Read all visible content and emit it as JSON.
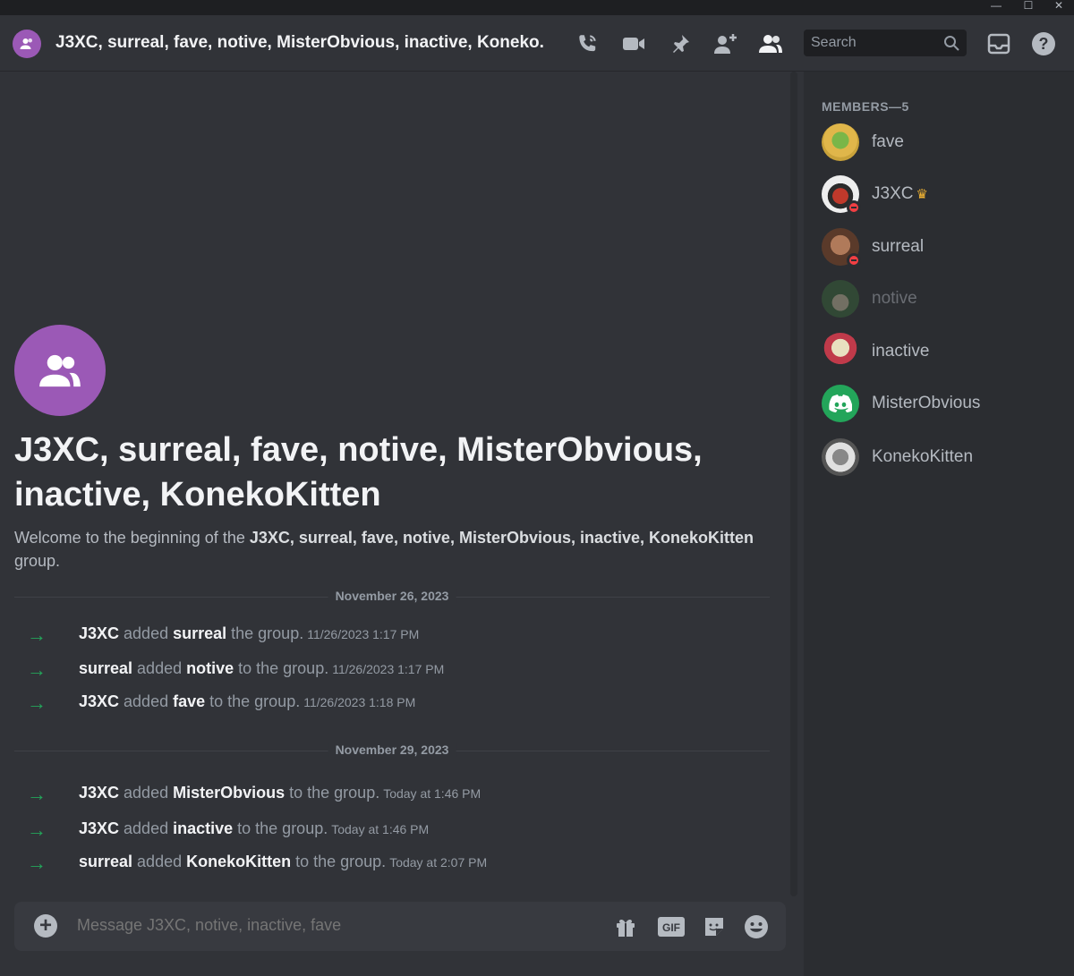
{
  "window": {
    "minimize": "—",
    "maximize": "☐",
    "close": "✕"
  },
  "header": {
    "title": "J3XC, surreal, fave, notive, MisterObvious, inactive, Koneko...",
    "search_placeholder": "Search",
    "icons": [
      "call-icon",
      "video-icon",
      "pin-icon",
      "add-friend-icon",
      "members-icon",
      "inbox-icon",
      "help-icon"
    ]
  },
  "intro": {
    "group_name": "J3XC, surreal, fave, notive, MisterObvious, inactive, KonekoKitten",
    "welcome_prefix": "Welcome to the beginning of the ",
    "welcome_names": "J3XC, surreal, fave, notive, MisterObvious, inactive, KonekoKitten",
    "welcome_suffix": " group."
  },
  "dividers": [
    "November 26, 2023",
    "November 29, 2023"
  ],
  "messages": [
    {
      "actor": "J3XC",
      "verb": " added ",
      "target": "surreal",
      "rest": " the group.",
      "time": "11/26/2023 1:17 PM"
    },
    {
      "actor": "surreal",
      "verb": " added ",
      "target": "notive",
      "rest": " to the group.",
      "time": "11/26/2023 1:17 PM"
    },
    {
      "actor": "J3XC",
      "verb": " added ",
      "target": "fave",
      "rest": " to the group.",
      "time": "11/26/2023 1:18 PM"
    },
    {
      "actor": "J3XC",
      "verb": " added ",
      "target": "MisterObvious",
      "rest": " to the group.",
      "time": "Today at 1:46 PM"
    },
    {
      "actor": "J3XC",
      "verb": " added ",
      "target": "inactive",
      "rest": " to the group.",
      "time": "Today at 1:46 PM"
    },
    {
      "actor": "surreal",
      "verb": " added ",
      "target": "KonekoKitten",
      "rest": " to the group.",
      "time": "Today at 2:07 PM"
    }
  ],
  "composer": {
    "placeholder": "Message J3XC, notive, inactive, fave",
    "gif_label": "GIF",
    "icons": [
      "add-attachment-icon",
      "gift-icon",
      "gif-icon",
      "sticker-icon",
      "emoji-icon"
    ]
  },
  "members": {
    "title": "MEMBERS—5",
    "list": [
      {
        "name": "fave",
        "avatar_color": "#c9a23a",
        "status": "none",
        "dim": false,
        "crown": false
      },
      {
        "name": "J3XC",
        "avatar_color": "#e8e8e8",
        "status": "dnd",
        "dim": false,
        "crown": true
      },
      {
        "name": "surreal",
        "avatar_color": "#7a4a3a",
        "status": "dnd",
        "dim": false,
        "crown": false
      },
      {
        "name": "notive",
        "avatar_color": "#3a5a3a",
        "status": "none",
        "dim": true,
        "crown": false
      },
      {
        "name": "inactive",
        "avatar_color": "#c03a4a",
        "status": "none",
        "dim": false,
        "crown": false
      },
      {
        "name": "MisterObvious",
        "avatar_color": "#23a55a",
        "status": "none",
        "dim": false,
        "crown": false
      },
      {
        "name": "KonekoKitten",
        "avatar_color": "#d8d8d8",
        "status": "none",
        "dim": false,
        "crown": false
      }
    ]
  }
}
